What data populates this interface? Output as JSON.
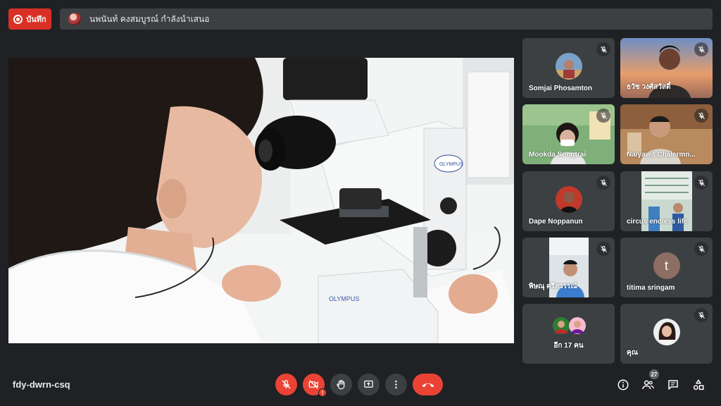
{
  "recording": {
    "label": "บันทึก"
  },
  "presenter": {
    "text": "นพนันท์ คงสมบูรณ์ กำลังนำเสนอ"
  },
  "participants": [
    {
      "name": "Somjai Phosamton"
    },
    {
      "name": "ธวัช วงศ์สวัสดิ์"
    },
    {
      "name": "Mookda Songtrai"
    },
    {
      "name": "Naiyawit Chalermn..."
    },
    {
      "name": "Dape Noppanun"
    },
    {
      "name": "circus endless life"
    },
    {
      "name": "พิษณุ ศรีสวรรณ์"
    },
    {
      "name": "titima sringam",
      "initial": "t"
    },
    {
      "name": "อีก 17 คน"
    },
    {
      "name": "คุณ"
    }
  ],
  "meeting": {
    "code": "fdy-dwrn-csq"
  },
  "people_count": "27",
  "colors": {
    "end_call": "#ea4335",
    "background": "#202124",
    "tile": "#3c4043"
  }
}
